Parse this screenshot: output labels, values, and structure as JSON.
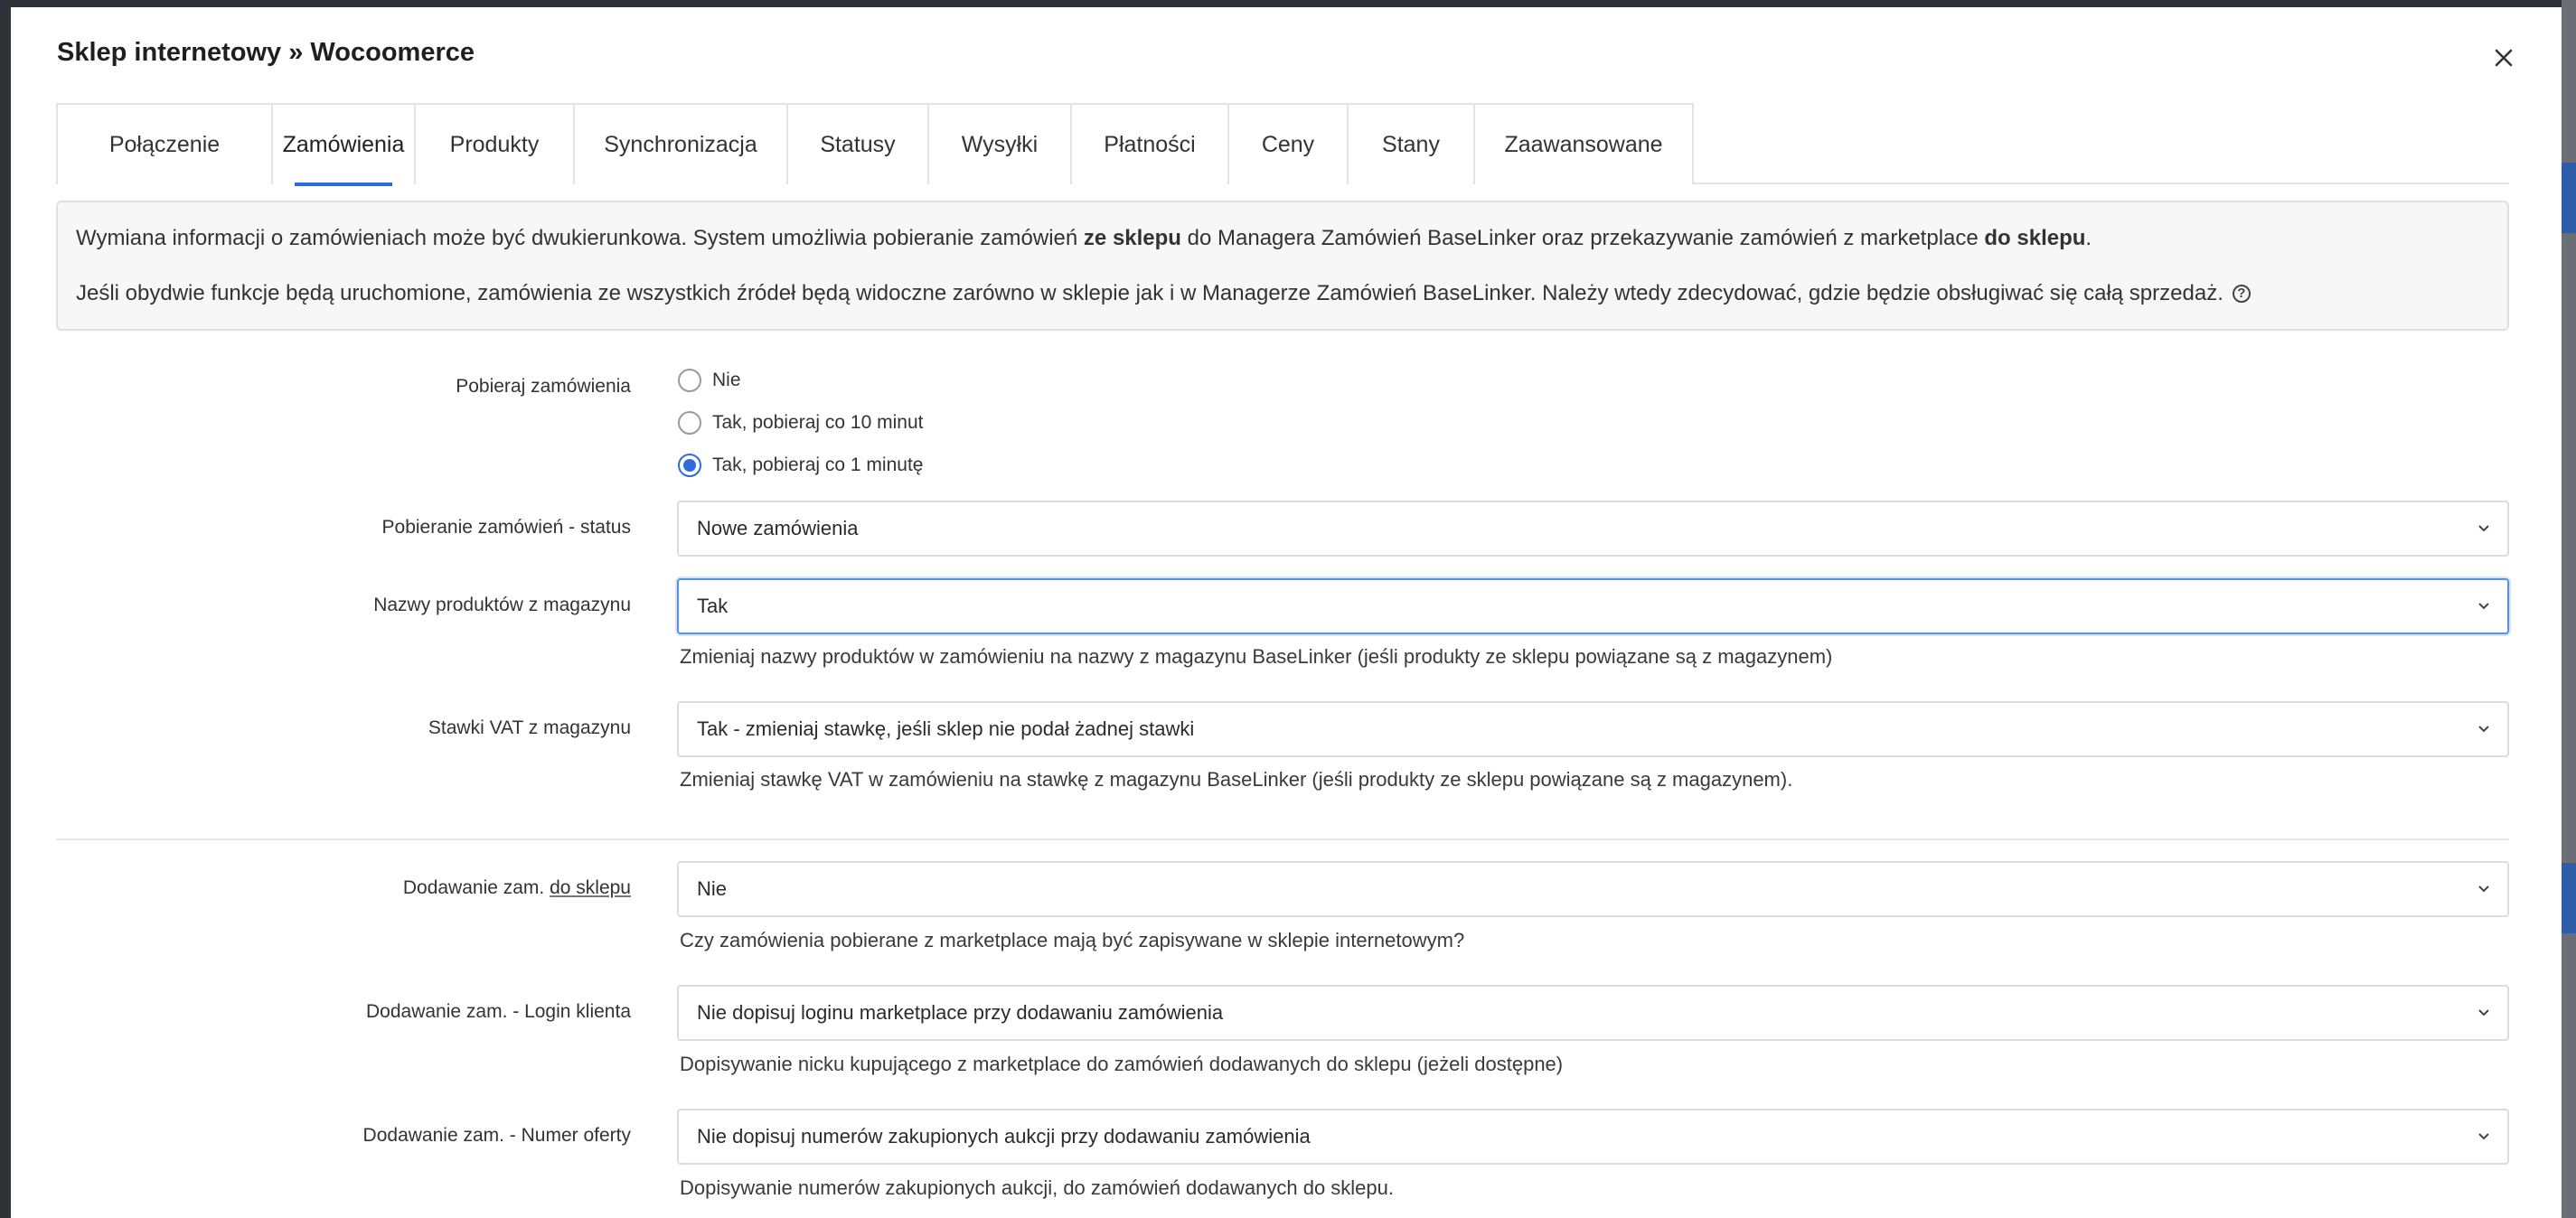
{
  "colors": {
    "accent": "#2d6be0",
    "backdrop": "#2f3238",
    "modal_bg": "#ffffff"
  },
  "modal": {
    "title": "Sklep internetowy » Wocoomerce",
    "close_icon": "close-icon"
  },
  "tabs": [
    {
      "label": "Połączenie",
      "active": false
    },
    {
      "label": "Zamówienia",
      "active": true
    },
    {
      "label": "Produkty",
      "active": false
    },
    {
      "label": "Synchronizacja",
      "active": false
    },
    {
      "label": "Statusy",
      "active": false
    },
    {
      "label": "Wysyłki",
      "active": false
    },
    {
      "label": "Płatności",
      "active": false
    },
    {
      "label": "Ceny",
      "active": false
    },
    {
      "label": "Stany",
      "active": false
    },
    {
      "label": "Zaawansowane",
      "active": false
    }
  ],
  "info": {
    "line1_part1": "Wymiana informacji o zamówieniach może być dwukierunkowa. System umożliwia pobieranie zamówień ",
    "line1_bold1": "ze sklepu",
    "line1_part2": " do Managera Zamówień BaseLinker oraz przekazywanie zamówień z marketplace ",
    "line1_bold2": "do sklepu",
    "line1_part3": ".",
    "line2": "Jeśli obydwie funkcje będą uruchomione, zamówienia ze wszystkich źródeł będą widoczne zarówno w sklepie jak i w Managerze Zamówień BaseLinker. Należy wtedy zdecydować, gdzie będzie obsługiwać się całą sprzedaż.",
    "help_icon": "question-circle-icon"
  },
  "form": {
    "fetch_orders": {
      "label": "Pobieraj zamówienia",
      "options": [
        {
          "label": "Nie",
          "checked": false
        },
        {
          "label": "Tak, pobieraj co 10 minut",
          "checked": false
        },
        {
          "label": "Tak, pobieraj co 1 minutę",
          "checked": true
        }
      ]
    },
    "fetch_status": {
      "label": "Pobieranie zamówień - status",
      "value": "Nowe zamówienia"
    },
    "product_names": {
      "label": "Nazwy produktów z magazynu",
      "value": "Tak",
      "hint": "Zmieniaj nazwy produktów w zamówieniu na nazwy z magazynu BaseLinker (jeśli produkty ze sklepu powiązane są z magazynem)"
    },
    "vat_rates": {
      "label": "Stawki VAT z magazynu",
      "value": "Tak - zmieniaj stawkę, jeśli sklep nie podał żadnej stawki",
      "hint": "Zmieniaj stawkę VAT w zamówieniu na stawkę z magazynu BaseLinker (jeśli produkty ze sklepu powiązane są z magazynem)."
    },
    "add_to_shop": {
      "label_prefix": "Dodawanie zam. ",
      "label_underlined": "do sklepu",
      "value": "Nie",
      "hint": "Czy zamówienia pobierane z marketplace mają być zapisywane w sklepie internetowym?"
    },
    "add_login": {
      "label": "Dodawanie zam. - Login klienta",
      "value": "Nie dopisuj loginu marketplace przy dodawaniu zamówienia",
      "hint": "Dopisywanie nicku kupującego z marketplace do zamówień dodawanych do sklepu (jeżeli dostępne)"
    },
    "add_offer_number": {
      "label": "Dodawanie zam. - Numer oferty",
      "value": "Nie dopisuj numerów zakupionych aukcji przy dodawaniu zamówienia",
      "hint": "Dopisywanie numerów zakupionych aukcji, do zamówień dodawanych do sklepu."
    }
  }
}
